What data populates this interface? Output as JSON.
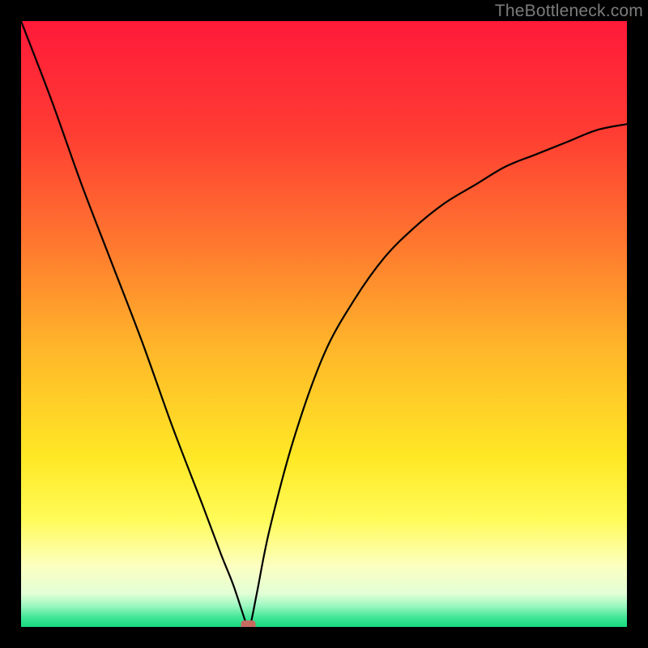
{
  "watermark": "TheBottleneck.com",
  "chart_data": {
    "type": "line",
    "title": "",
    "xlabel": "",
    "ylabel": "",
    "xlim": [
      0,
      100
    ],
    "ylim": [
      0,
      100
    ],
    "x": [
      0,
      5,
      10,
      15,
      20,
      25,
      30,
      33,
      35,
      37,
      37.5,
      38,
      39,
      41,
      45,
      50,
      55,
      60,
      65,
      70,
      75,
      80,
      85,
      90,
      95,
      100
    ],
    "values": [
      100,
      87,
      73,
      60,
      47,
      33,
      20,
      12,
      7,
      1,
      0,
      1,
      6,
      16,
      31,
      45,
      54,
      61,
      66,
      70,
      73,
      76,
      78,
      80,
      82,
      83
    ],
    "minimum_x": 37.5,
    "marker": {
      "x": 37.5,
      "y": 0,
      "color": "#c76a60"
    },
    "gradient_stops": [
      {
        "pos": 0.0,
        "color": "#ff1a3a"
      },
      {
        "pos": 0.18,
        "color": "#ff3b33"
      },
      {
        "pos": 0.36,
        "color": "#ff752f"
      },
      {
        "pos": 0.54,
        "color": "#ffb62a"
      },
      {
        "pos": 0.72,
        "color": "#ffe825"
      },
      {
        "pos": 0.82,
        "color": "#fffb56"
      },
      {
        "pos": 0.9,
        "color": "#fcffc0"
      },
      {
        "pos": 0.945,
        "color": "#e2ffd6"
      },
      {
        "pos": 0.965,
        "color": "#9cf7c0"
      },
      {
        "pos": 0.985,
        "color": "#3ee696"
      },
      {
        "pos": 1.0,
        "color": "#17d87f"
      }
    ]
  }
}
